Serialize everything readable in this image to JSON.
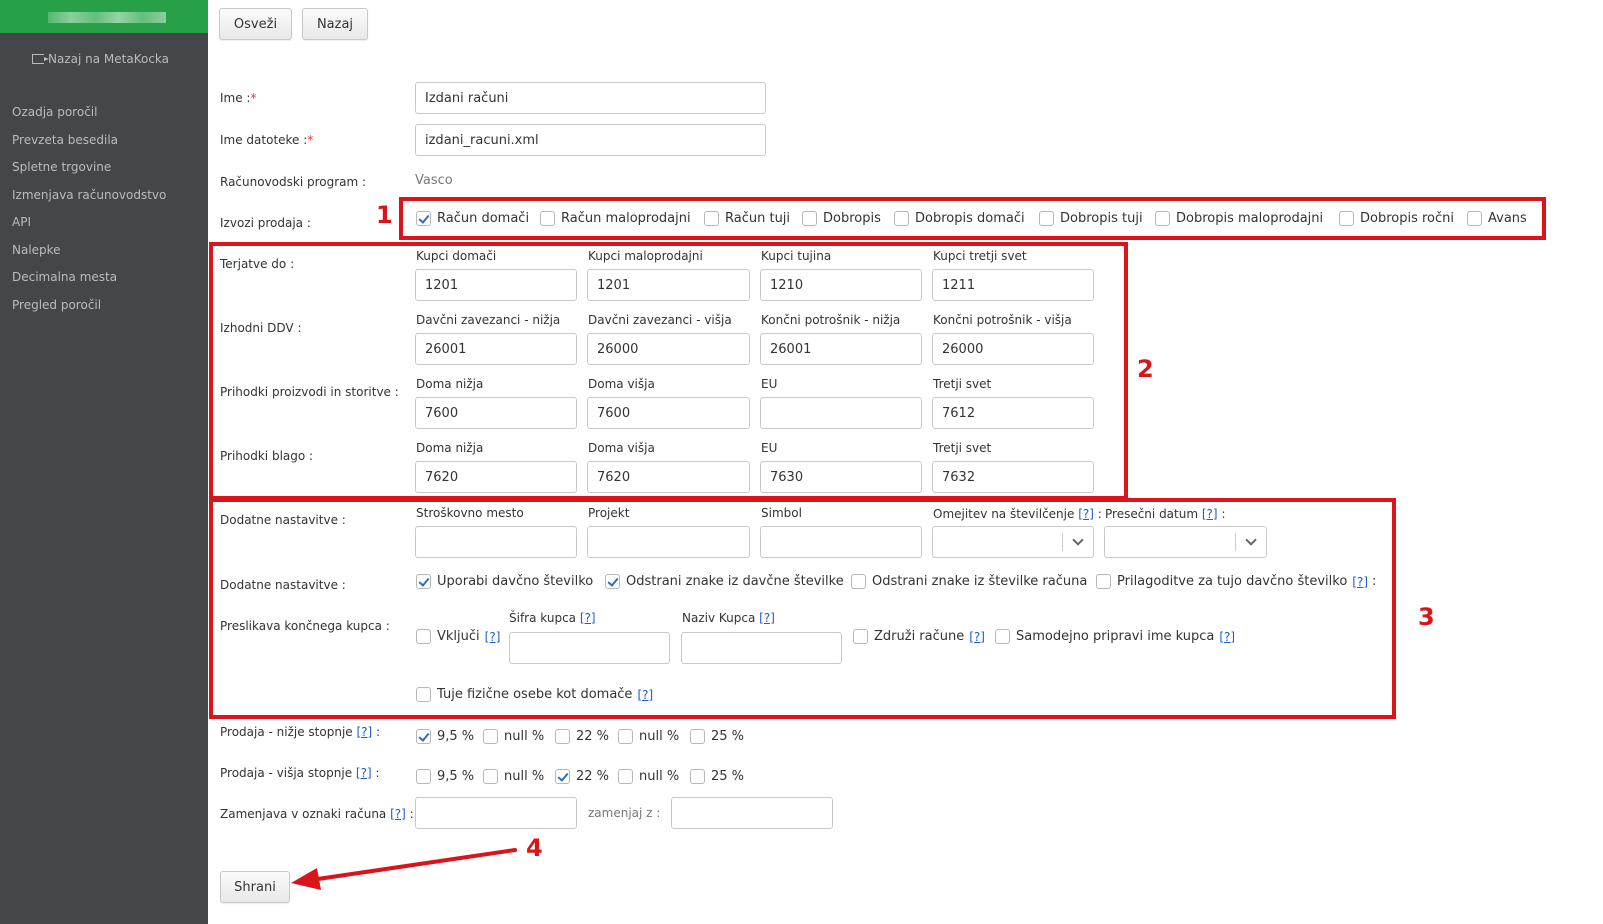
{
  "sidebar": {
    "back_link": "Nazaj na MetaKocka",
    "items": [
      "Ozadja poročil",
      "Prevzeta besedila",
      "Spletne trgovine",
      "Izmenjava računovodstvo",
      "API",
      "Nalepke",
      "Decimalna mesta",
      "Pregled poročil"
    ]
  },
  "toolbar": {
    "refresh_label": "Osveži",
    "back_label": "Nazaj"
  },
  "form": {
    "name_label": "Ime :",
    "name_value": "Izdani računi",
    "filename_label": "Ime datoteke :",
    "filename_value": "izdani_racuni.xml",
    "required_mark": "*",
    "program_label": "Računovodski program :",
    "program_value": "Vasco",
    "export_label": "Izvozi prodaja :",
    "export_options": [
      {
        "label": "Račun domači",
        "checked": true
      },
      {
        "label": "Račun maloprodajni",
        "checked": false
      },
      {
        "label": "Račun tuji",
        "checked": false
      },
      {
        "label": "Dobropis",
        "checked": false
      },
      {
        "label": "Dobropis domači",
        "checked": false
      },
      {
        "label": "Dobropis tuji",
        "checked": false
      },
      {
        "label": "Dobropis maloprodajni",
        "checked": false
      },
      {
        "label": "Dobropis ročni",
        "checked": false
      },
      {
        "label": "Avans",
        "checked": false
      }
    ],
    "accounts": [
      {
        "label": "Terjatve do :",
        "cols": [
          "Kupci domači",
          "Kupci maloprodajni",
          "Kupci tujina",
          "Kupci tretji svet"
        ],
        "values": [
          "1201",
          "1201",
          "1210",
          "1211"
        ]
      },
      {
        "label": "Izhodni DDV :",
        "cols": [
          "Davčni zavezanci - nižja",
          "Davčni zavezanci - višja",
          "Končni potrošnik - nižja",
          "Končni potrošnik - višja"
        ],
        "values": [
          "26001",
          "26000",
          "26001",
          "26000"
        ]
      },
      {
        "label": "Prihodki proizvodi in storitve :",
        "cols": [
          "Doma nižja",
          "Doma višja",
          "EU",
          "Tretji svet"
        ],
        "values": [
          "7600",
          "7600",
          "",
          "7612"
        ]
      },
      {
        "label": "Prihodki blago :",
        "cols": [
          "Doma nižja",
          "Doma višja",
          "EU",
          "Tretji svet"
        ],
        "values": [
          "7620",
          "7620",
          "7630",
          "7632"
        ]
      }
    ],
    "extra": {
      "label": "Dodatne nastavitve :",
      "cols": [
        "Stroškovno mesto",
        "Projekt",
        "Simbol"
      ],
      "limit_label": "Omejitev na številčenje",
      "cutoff_label": "Presečni datum",
      "colon": ":"
    },
    "extra2": {
      "label": "Dodatne nastavitve :",
      "options": [
        {
          "label": "Uporabi davčno številko",
          "checked": true
        },
        {
          "label": "Odstrani znake iz davčne številke",
          "checked": true
        },
        {
          "label": "Odstrani znake iz številke računa",
          "checked": false
        },
        {
          "label": "Prilagoditve za tujo davčno številko",
          "checked": false
        }
      ]
    },
    "mapping": {
      "label": "Preslikava končnega kupca :",
      "include": "Vključi",
      "code_label": "Šifra kupca",
      "name_label": "Naziv Kupca",
      "merge": "Združi račune",
      "auto_name": "Samodejno pripravi ime kupca",
      "foreign": "Tuje fizične osebe kot domače"
    },
    "help": "[?]",
    "sales_low": {
      "label": "Prodaja - nižje stopnje",
      "options": [
        {
          "label": "9,5 %",
          "checked": true
        },
        {
          "label": "null %",
          "checked": false
        },
        {
          "label": "22 %",
          "checked": false
        },
        {
          "label": "null %",
          "checked": false
        },
        {
          "label": "25 %",
          "checked": false
        }
      ]
    },
    "sales_high": {
      "label": "Prodaja - višja stopnje",
      "options": [
        {
          "label": "9,5 %",
          "checked": false
        },
        {
          "label": "null %",
          "checked": false
        },
        {
          "label": "22 %",
          "checked": true
        },
        {
          "label": "null %",
          "checked": false
        },
        {
          "label": "25 %",
          "checked": false
        }
      ]
    },
    "replace_label": "Zamenjava v oznaki računa",
    "replace_with": "zamenjaj z :",
    "save_label": "Shrani"
  },
  "annotations": {
    "n1": "1",
    "n2": "2",
    "n3": "3",
    "n4": "4",
    "color": "#d9141b"
  },
  "colors": {
    "sidebar": "#444749",
    "brand": "#27a047",
    "link": "#1a5ec9",
    "check": "#2a6ebb"
  }
}
